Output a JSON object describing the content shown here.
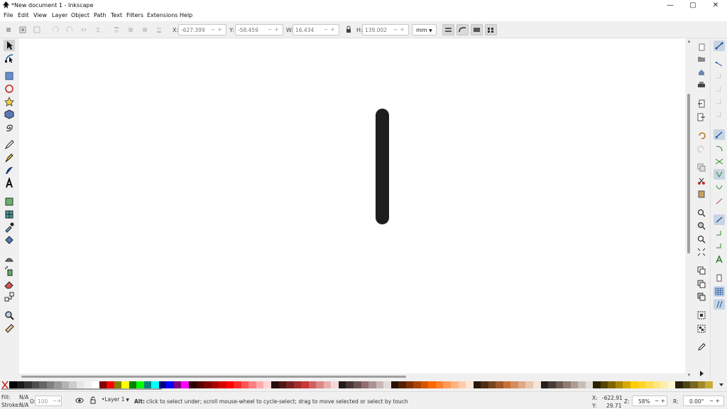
{
  "window": {
    "title": "*New document 1 - Inkscape",
    "minimize": "—",
    "maximize": "▢",
    "close": "✕"
  },
  "menu": [
    "File",
    "Edit",
    "View",
    "Layer",
    "Object",
    "Path",
    "Text",
    "Filters",
    "Extensions",
    "Help"
  ],
  "toolbar": {
    "x_label": "X:",
    "x_value": "-627.399",
    "y_label": "Y:",
    "y_value": "-58.459",
    "w_label": "W:",
    "w_value": "16.434",
    "h_label": "H:",
    "h_value": "139.002",
    "unit": "mm"
  },
  "toolbox": [
    "selector",
    "node",
    "rectangle",
    "ellipse",
    "star",
    "3d-box",
    "spiral",
    "pencil",
    "pen",
    "calligraphy",
    "text",
    "gradient",
    "mesh",
    "dropper",
    "paint-bucket",
    "tweak",
    "spray",
    "eraser",
    "connector",
    "zoom",
    "measure"
  ],
  "palette_colors": [
    "#000000",
    "#1a1a1a",
    "#333333",
    "#4d4d4d",
    "#666666",
    "#808080",
    "#999999",
    "#b3b3b3",
    "#cccccc",
    "#e6e6e6",
    "#f2f2f2",
    "#ffffff",
    "#800000",
    "#ff0000",
    "#808000",
    "#ffff00",
    "#008000",
    "#00ff00",
    "#008080",
    "#00ffff",
    "#000080",
    "#0000ff",
    "#800080",
    "#ff00ff",
    "#2b0000",
    "#550000",
    "#800000",
    "#aa0000",
    "#d40000",
    "#ff0000",
    "#ff2a2a",
    "#ff5555",
    "#ff8080",
    "#ffaaaa",
    "#ffd5d5",
    "#280b0b",
    "#501616",
    "#782121",
    "#a02c2c",
    "#c83737",
    "#d35f5f",
    "#de8787",
    "#e9afaf",
    "#f4d7d7",
    "#241c1c",
    "#483737",
    "#6c5353",
    "#916f6f",
    "#ac9393",
    "#c8b7b7",
    "#e3dbdb",
    "#2b1100",
    "#552200",
    "#803300",
    "#aa4400",
    "#d45500",
    "#ff6600",
    "#ff7f2a",
    "#ff9955",
    "#ffb380",
    "#ffccaa",
    "#ffe6d5",
    "#28170b",
    "#502d16",
    "#784421",
    "#a05a2c",
    "#c87137",
    "#d38d5f",
    "#deaa87",
    "#e9c6af",
    "#f4e3d7",
    "#241f1c",
    "#483e37",
    "#6c5d53",
    "#917c6f",
    "#ac9d93",
    "#c8beb7",
    "#e3dedb",
    "#2b2200",
    "#554400",
    "#806600",
    "#aa8800",
    "#d4aa00",
    "#ffcc00",
    "#ffd42a",
    "#ffdd55",
    "#ffe680",
    "#ffeeaa",
    "#fff6d5",
    "#28220b",
    "#504416",
    "#786721",
    "#a0892c",
    "#c8ab37"
  ],
  "status": {
    "fill_label": "Fill:",
    "fill_value": "N/A",
    "stroke_label": "Stroke:",
    "stroke_value": "N/A",
    "opacity_label": "O:",
    "opacity_value": "100",
    "layer": "Layer 1",
    "message_bold": "Alt:",
    "message": "click to select under; scroll mouse-wheel to cycle-select; drag to move selected or select by touch",
    "x_label": "X:",
    "x_value": "-622.91",
    "y_label": "Y:",
    "y_value": "29.71",
    "zoom_label": "Z:",
    "zoom_value": "58%",
    "rotation_label": "R:",
    "rotation_value": "0.00°"
  }
}
